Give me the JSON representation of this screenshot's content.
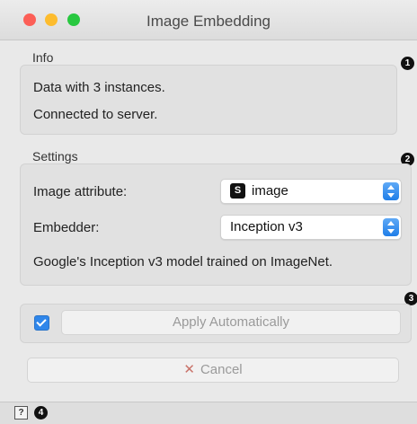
{
  "window": {
    "title": "Image Embedding"
  },
  "info": {
    "group_label": "Info",
    "marker": "1",
    "lines": [
      "Data with 3 instances.",
      "Connected to server."
    ]
  },
  "settings": {
    "group_label": "Settings",
    "marker": "2",
    "image_attribute_label": "Image attribute:",
    "image_attribute_type_badge": "S",
    "image_attribute_value": "image",
    "embedder_label": "Embedder:",
    "embedder_value": "Inception v3",
    "description": "Google's Inception v3 model trained on ImageNet."
  },
  "apply": {
    "marker": "3",
    "auto_checked": true,
    "apply_label": "Apply Automatically",
    "cancel_label": "Cancel"
  },
  "statusbar": {
    "help_glyph": "?",
    "marker": "4"
  }
}
